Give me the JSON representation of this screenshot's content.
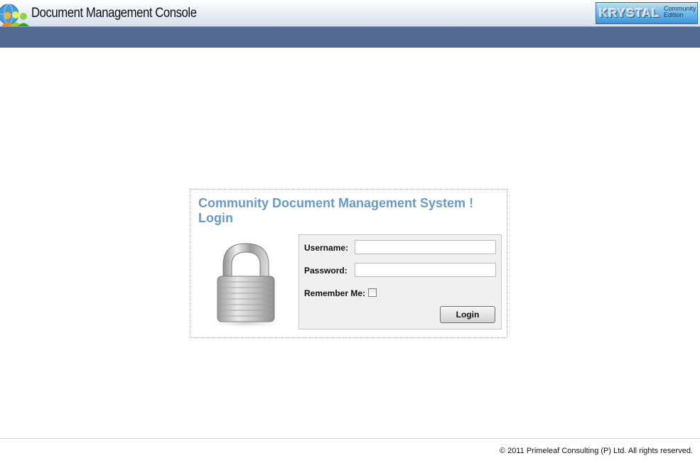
{
  "header": {
    "app_title": "Document Management Console",
    "brand": {
      "name": "KRYSTAL",
      "edition": "Community Edition"
    },
    "logo_icon": "users-globe-icon"
  },
  "login": {
    "heading": "Community Document Management System ! Login",
    "lock_icon": "padlock-icon",
    "username_label": "Username:",
    "username_value": "",
    "password_label": "Password:",
    "password_value": "",
    "remember_label": "Remember Me:",
    "remember_checked": false,
    "login_button": "Login"
  },
  "footer": {
    "copyright": "© 2011 Primeleaf Consulting (P) Ltd. All rights reserved."
  },
  "colors": {
    "navbar": "#536a92",
    "heading": "#6b99c6"
  }
}
